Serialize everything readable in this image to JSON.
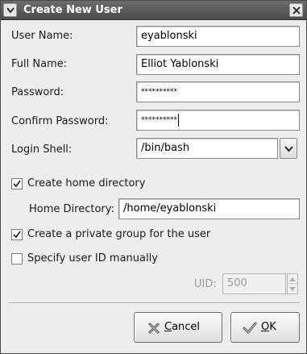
{
  "window": {
    "title": "Create New User"
  },
  "form": {
    "user_name": {
      "label": "User Name:",
      "value": "eyablonski"
    },
    "full_name": {
      "label": "Full Name:",
      "value": "Elliot Yablonski"
    },
    "password": {
      "label": "Password:",
      "value": "**********"
    },
    "confirm_password": {
      "label": "Confirm Password:",
      "value": "**********"
    },
    "login_shell": {
      "label": "Login Shell:",
      "value": "/bin/bash"
    },
    "create_home": {
      "label": "Create home directory",
      "checked": true
    },
    "home_directory": {
      "label": "Home Directory:",
      "value": "/home/eyablonski"
    },
    "private_group": {
      "label": "Create a private group for the user",
      "checked": true
    },
    "specify_uid": {
      "label": "Specify user ID manually",
      "checked": false
    },
    "uid": {
      "label": "UID:",
      "value": "500"
    }
  },
  "buttons": {
    "cancel": {
      "mnemonic": "C",
      "rest": "ancel"
    },
    "ok": {
      "mnemonic": "O",
      "rest": "K"
    }
  }
}
